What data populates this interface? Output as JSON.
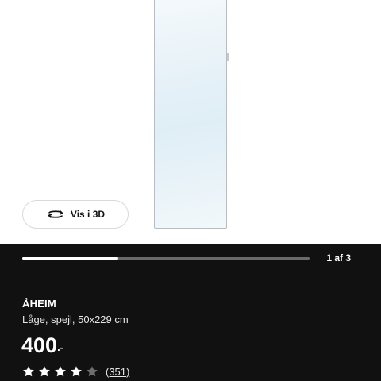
{
  "gallery": {
    "view_3d_label": "Vis i 3D",
    "view_3d_icon": "rotate-360-icon",
    "progress_fraction": 0.3333,
    "counter": "1 af 3"
  },
  "product": {
    "name": "ÅHEIM",
    "description": "Låge, spejl, 50x229 cm",
    "price": "400",
    "price_suffix": ".-",
    "rating": 4,
    "rating_max": 5,
    "review_count": "(351)"
  },
  "colors": {
    "panel_bg": "#111111",
    "star_filled": "#ffffff",
    "star_empty": "#6e6e6e"
  }
}
